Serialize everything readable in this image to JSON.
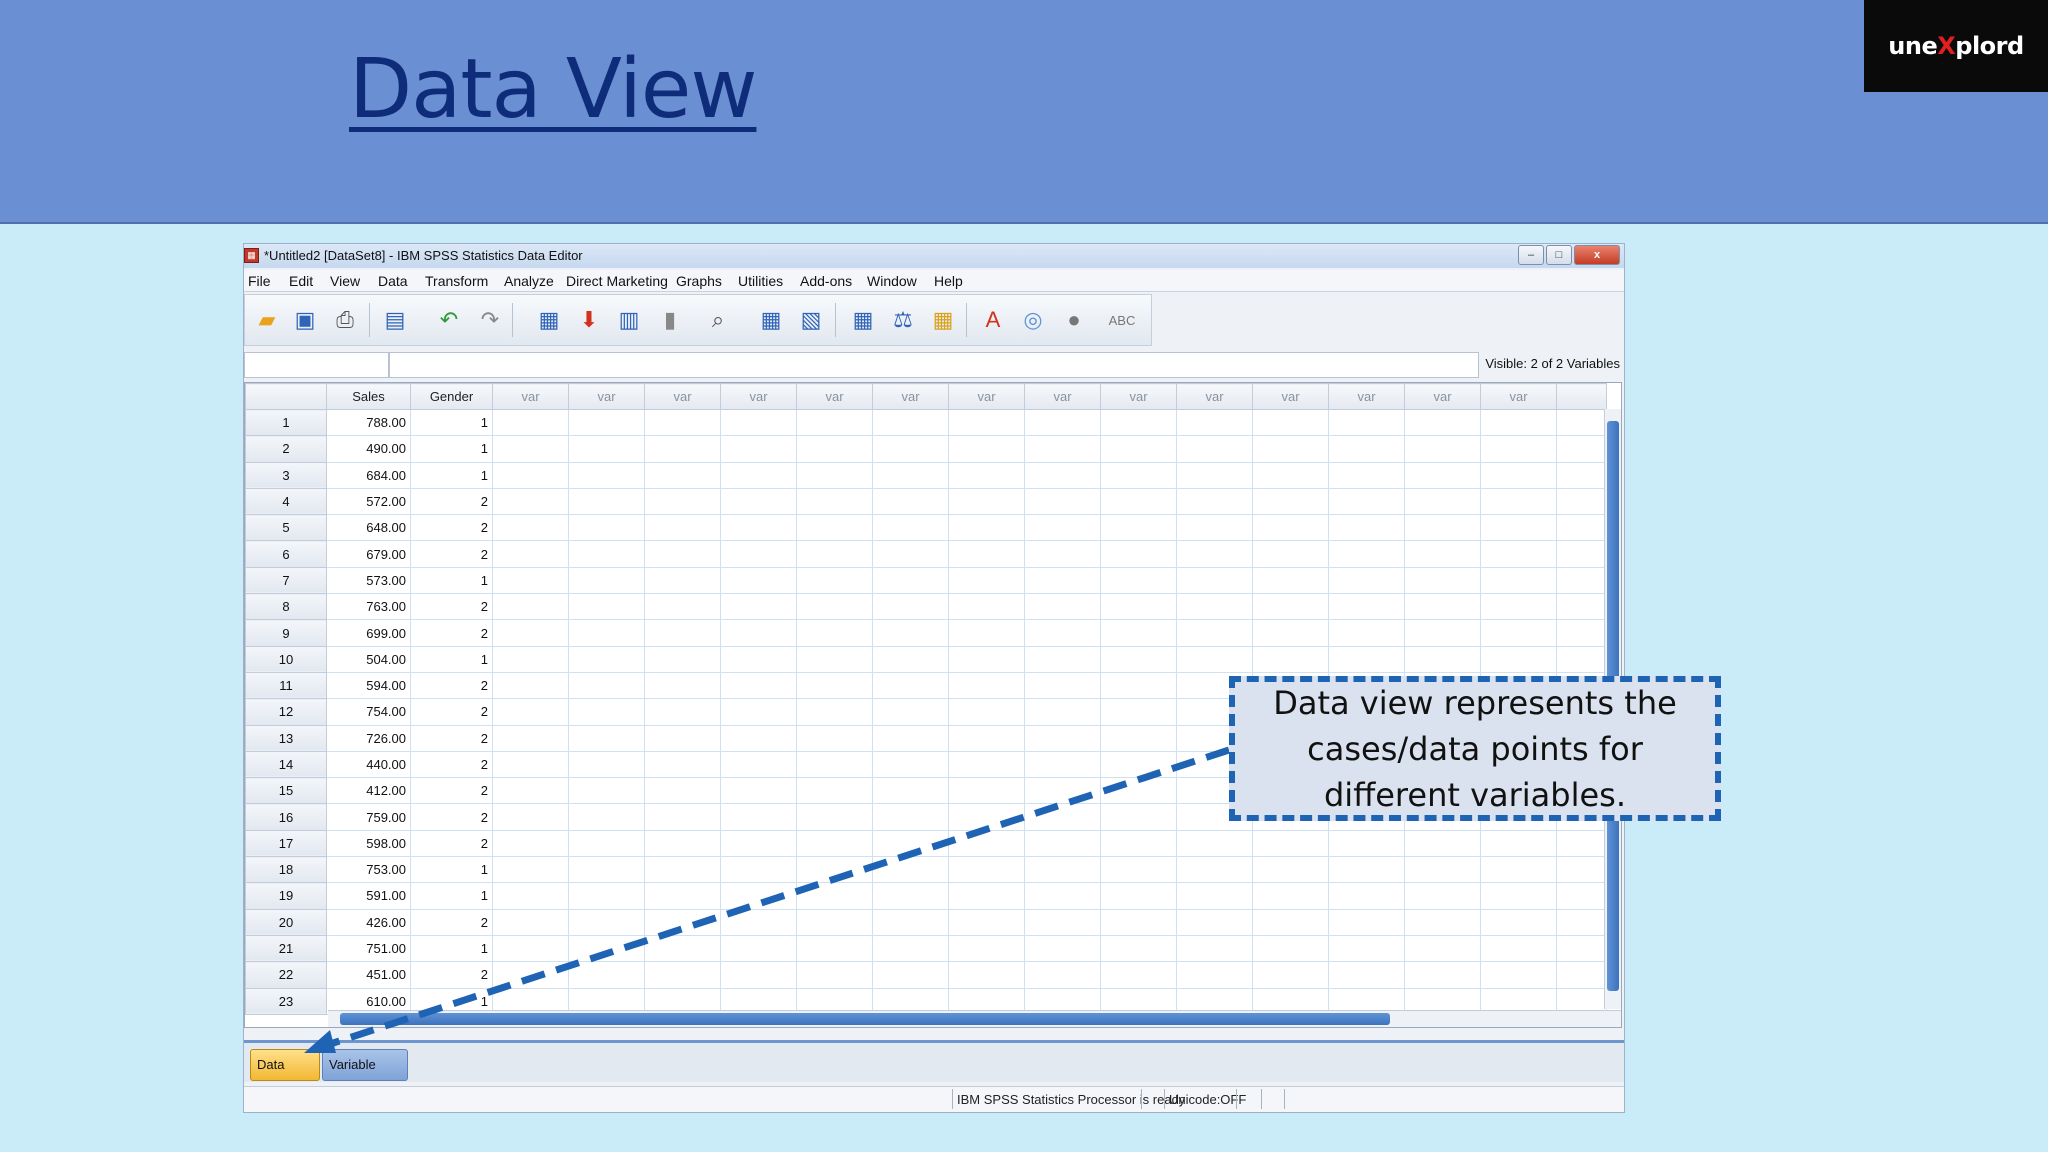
{
  "slide": {
    "title": "Data View",
    "logo_left": "une",
    "logo_x": "X",
    "logo_right": "plord"
  },
  "window": {
    "title": "*Untitled2 [DataSet8] - IBM SPSS Statistics Data Editor",
    "min": "–",
    "max": "□",
    "close": "x"
  },
  "menu": [
    "File",
    "Edit",
    "View",
    "Data",
    "Transform",
    "Analyze",
    "Direct Marketing",
    "Graphs",
    "Utilities",
    "Add-ons",
    "Window",
    "Help"
  ],
  "toolbar_icons": [
    "open-folder-icon",
    "save-icon",
    "print-icon",
    "recall-dialog-icon",
    "undo-icon",
    "redo-icon",
    "goto-case-icon",
    "goto-variable-icon",
    "variables-icon",
    "run-descriptives-icon",
    "find-icon",
    "insert-cases-icon",
    "insert-variable-icon",
    "split-file-icon",
    "weight-cases-icon",
    "select-cases-icon",
    "value-labels-icon",
    "use-sets-icon",
    "show-all-variables-icon",
    "spell-check-icon"
  ],
  "cellbar": {
    "visible": "Visible: 2 of 2 Variables"
  },
  "grid": {
    "columns": [
      "Sales",
      "Gender"
    ],
    "var_label": "var",
    "rows": [
      [
        "788.00",
        "1"
      ],
      [
        "490.00",
        "1"
      ],
      [
        "684.00",
        "1"
      ],
      [
        "572.00",
        "2"
      ],
      [
        "648.00",
        "2"
      ],
      [
        "679.00",
        "2"
      ],
      [
        "573.00",
        "1"
      ],
      [
        "763.00",
        "2"
      ],
      [
        "699.00",
        "2"
      ],
      [
        "504.00",
        "1"
      ],
      [
        "594.00",
        "2"
      ],
      [
        "754.00",
        "2"
      ],
      [
        "726.00",
        "2"
      ],
      [
        "440.00",
        "2"
      ],
      [
        "412.00",
        "2"
      ],
      [
        "759.00",
        "2"
      ],
      [
        "598.00",
        "2"
      ],
      [
        "753.00",
        "1"
      ],
      [
        "591.00",
        "1"
      ],
      [
        "426.00",
        "2"
      ],
      [
        "751.00",
        "1"
      ],
      [
        "451.00",
        "2"
      ],
      [
        "610.00",
        "1"
      ]
    ]
  },
  "tabs": {
    "data_view": "Data View",
    "variable_view": "Variable View"
  },
  "status": {
    "processor": "IBM SPSS Statistics Processor is ready",
    "unicode": "Unicode:OFF"
  },
  "callout": {
    "text": "Data view represents the cases/data points for different variables."
  }
}
